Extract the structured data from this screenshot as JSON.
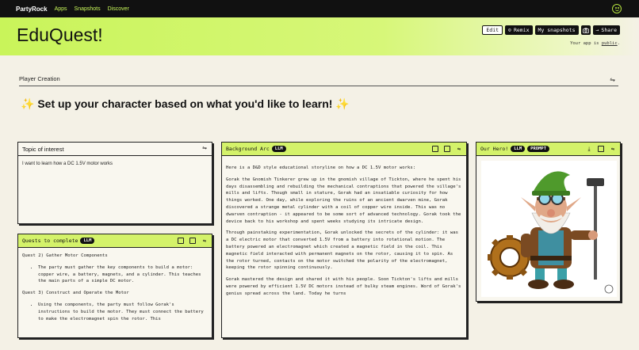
{
  "nav": {
    "brand": "PartyRock",
    "links": [
      "Apps",
      "Snapshots",
      "Discover"
    ]
  },
  "app": {
    "title": "EduQuest!",
    "buttons": {
      "edit": "Edit",
      "remix": "Remix",
      "snapshots": "My snapshots",
      "share": "Share"
    },
    "public_prefix": "Your app is ",
    "public_link": "public",
    "public_suffix": "."
  },
  "section": {
    "title": "Player Creation"
  },
  "heading": {
    "spark": "✨",
    "text": " Set up your character based on what you'd like to learn! "
  },
  "topic": {
    "title": "Topic of interest",
    "value": "I want to learn how a DC 1.5V motor works"
  },
  "quests": {
    "title": "Quests to complete",
    "badge": "LLM",
    "items": [
      {
        "heading": "Quest 2) Gather Motor Components",
        "bullet": "The party must gather the key components to build a motor: copper wire, a battery, magnets, and a cylinder. This teaches the main parts of a simple DC motor."
      },
      {
        "heading": "Quest 3) Construct and Operate the Motor",
        "bullet": "Using the components, the party must follow Gorak's instructions to build the motor. They must connect the battery to make the electromagnet spin the rotor. This"
      }
    ]
  },
  "arc": {
    "title": "Background Arc",
    "badge": "LLM",
    "paragraphs": [
      "Here is a D&D style educational storyline on how a DC 1.5V motor works:",
      "Gorak the Gnomish Tinkerer grew up in the gnomish village of Tickton, where he spent his days disassembling and rebuilding the mechanical contraptions that powered the village's mills and lifts. Though small in stature, Gorak had an insatiable curiosity for how things worked. One day, while exploring the ruins of an ancient dwarven mine, Gorak discovered a strange metal cylinder with a coil of copper wire inside. This was no dwarven contraption - it appeared to be some sort of advanced technology. Gorak took the device back to his workshop and spent weeks studying its intricate design.",
      "Through painstaking experimentation, Gorak unlocked the secrets of the cylinder: it was a DC electric motor that converted 1.5V from a battery into rotational motion. The battery powered an electromagnet which created a magnetic field in the coil. This magnetic field interacted with permanent magnets on the rotor, causing it to spin. As the rotor turned, contacts on the motor switched the polarity of the electromagnet, keeping the rotor spinning continuously.",
      "Gorak mastered the design and shared it with his people. Soon Tickton's lifts and mills were powered by efficient 1.5V DC motors instead of bulky steam engines. Word of Gorak's genius spread across the land. Today he turns"
    ]
  },
  "hero": {
    "title": "Our Hero!",
    "badge1": "LLM",
    "badge2": "PROMPT"
  },
  "icons": [
    "smiley-icon",
    "camera-icon",
    "share-arrow-icon",
    "sliders-icon",
    "copy-icon",
    "save-icon",
    "download-icon"
  ]
}
